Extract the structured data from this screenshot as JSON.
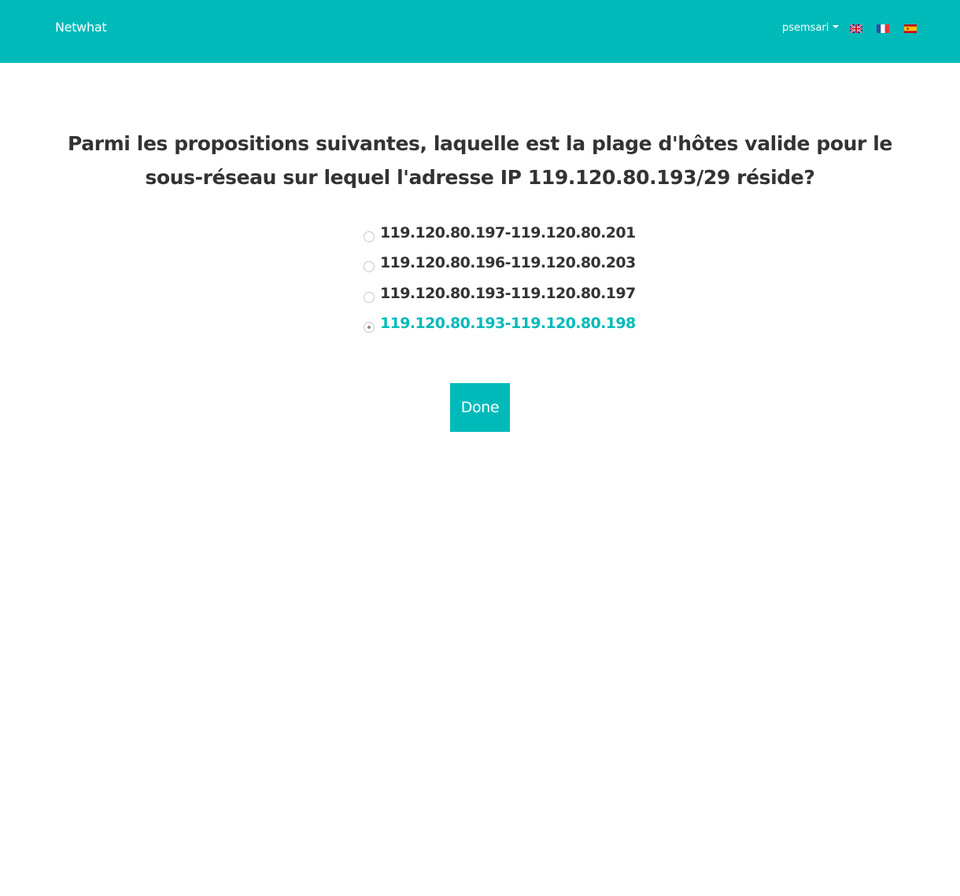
{
  "navbar": {
    "brand": "Netwhat",
    "username": "psemsari",
    "languages": [
      {
        "code": "en",
        "icon": "uk-flag-icon"
      },
      {
        "code": "fr",
        "icon": "france-flag-icon"
      },
      {
        "code": "es",
        "icon": "spain-flag-icon"
      }
    ]
  },
  "quiz": {
    "question": "Parmi les propositions suivantes, laquelle est la plage d'hôtes valide pour le sous-réseau sur lequel l'adresse IP 119.120.80.193/29 réside?",
    "answers": [
      {
        "label": "119.120.80.197-119.120.80.201",
        "selected": false
      },
      {
        "label": "119.120.80.196-119.120.80.203",
        "selected": false
      },
      {
        "label": "119.120.80.193-119.120.80.197",
        "selected": false
      },
      {
        "label": "119.120.80.193-119.120.80.198",
        "selected": true
      }
    ],
    "submit_label": "Done"
  },
  "colors": {
    "accent": "#00BABA",
    "text": "#333333",
    "background": "#ffffff"
  }
}
